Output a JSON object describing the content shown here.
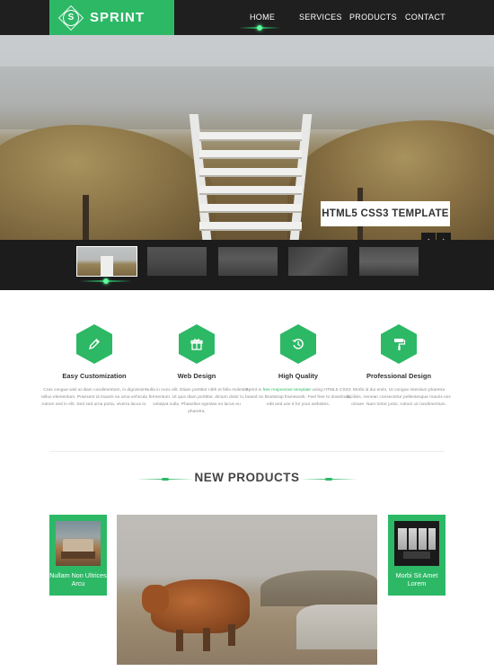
{
  "nav": {
    "brand_letter": "S",
    "brand_name": "SPRINT",
    "items": [
      {
        "label": "HOME",
        "active": true
      },
      {
        "label": "SERVICES",
        "active": false
      },
      {
        "label": "PRODUCTS",
        "active": false
      },
      {
        "label": "CONTACT",
        "active": false
      }
    ]
  },
  "hero": {
    "caption": "HTML5 CSS3 TEMPLATE",
    "prev_icon": "chevron-left-icon",
    "next_icon": "chevron-right-icon",
    "prev_glyph": "‹",
    "next_glyph": "›"
  },
  "thumbnails": {
    "count": 5,
    "active_index": 0
  },
  "features": [
    {
      "icon": "pencil-icon",
      "title": "Easy Customization",
      "text": "Cras congue wisl at diam condimentum, in dignissim tellus elementum. Praesent id mauris eu urna vehicula rutrum sed in elit. Sed sed urna porta, viverra lacus in."
    },
    {
      "icon": "gift-icon",
      "title": "Web Design",
      "text": "Nulla in nunc elit. Etiam porttitor nibh et felis molestie fermentum. Ut quis diam porttitor, dictum dolor in, volutpat nulla. Phasellus egestas eu lacus eu pharetra."
    },
    {
      "icon": "history-icon",
      "title": "High Quality",
      "text_before": "Sprint is ",
      "text_link": "free responsive template",
      "text_after": " using HTML5 CSS3 based on Bootstrap framework. Feel free to download, edit and use it for your websites."
    },
    {
      "icon": "paint-roller-icon",
      "title": "Professional Design",
      "text": "Morbi id dui enim. Ut congue interdum pharetra facilisis. Aenean consectetur pellentesque mauris nec ornare. Nam tortor justo, rutrum ut condimentum."
    }
  ],
  "products": {
    "section_title": "NEW PRODUCTS",
    "left_card": {
      "label": "Nullam Non Ultrices Arcu"
    },
    "right_card": {
      "label": "Morbi Sit Amet Lorem"
    }
  },
  "colors": {
    "accent": "#2db866",
    "nav_bg": "#1f1f1f",
    "thumb_bg": "#1c1c1c"
  }
}
